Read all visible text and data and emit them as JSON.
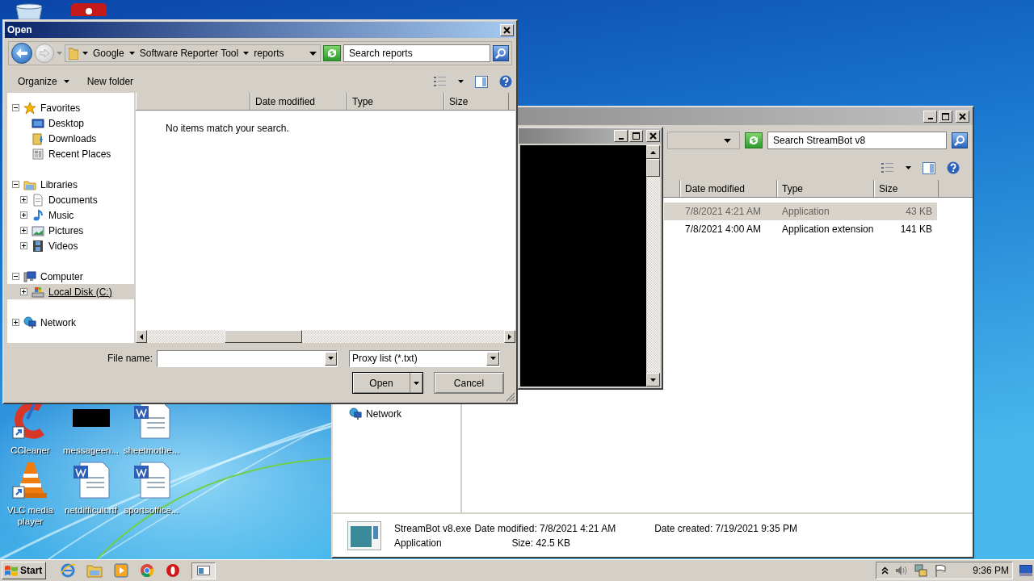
{
  "desktop": {
    "top_icons": [
      {
        "kind": "recycle_bin"
      },
      {
        "kind": "red_app"
      }
    ],
    "icons": [
      {
        "kind": "app_red_c",
        "label": "CCleaner"
      },
      {
        "kind": "blank_thumb",
        "label": "messageen..."
      },
      {
        "kind": "word_doc",
        "label": "sheetmothe..."
      },
      {
        "kind": "cone",
        "label": "VLC media player"
      },
      {
        "kind": "word_doc",
        "label": "netdifficult.rtf"
      },
      {
        "kind": "word_doc",
        "label": "sportsoffice..."
      }
    ]
  },
  "explorer": {
    "search": {
      "placeholder": "Search StreamBot v8"
    },
    "columns": [
      "Date modified",
      "Type",
      "Size"
    ],
    "rows": [
      {
        "date": "7/8/2021 4:21 AM",
        "type": "Application",
        "size": "43 KB",
        "selected": true
      },
      {
        "date": "7/8/2021 4:00 AM",
        "type": "Application extension",
        "size": "141 KB",
        "selected": false
      }
    ],
    "nav": [
      {
        "label": "Network",
        "kind": "network"
      }
    ],
    "details": {
      "name": "StreamBot v8.exe",
      "type": "Application",
      "date_modified_label": "Date modified:",
      "date_modified": "7/8/2021 4:21 AM",
      "size_label": "Size:",
      "size": "42.5 KB",
      "date_created_label": "Date created:",
      "date_created": "7/19/2021 9:35 PM"
    }
  },
  "dialog": {
    "title": "Open",
    "breadcrumb": [
      "Google",
      "Software Reporter Tool",
      "reports"
    ],
    "search": {
      "placeholder": "Search reports"
    },
    "toolbar": [
      {
        "label": "Organize",
        "kind": "menu"
      },
      {
        "label": "New folder",
        "kind": "plain"
      }
    ],
    "columns": [
      "Date modified",
      "Type",
      "Size"
    ],
    "empty_message": "No items match your search.",
    "tree": [
      {
        "label": "Favorites",
        "kind": "favorites",
        "expanded": true,
        "selected": false,
        "children": [
          {
            "label": "Desktop",
            "kind": "desktop",
            "selected": false
          },
          {
            "label": "Downloads",
            "kind": "downloads",
            "selected": false
          },
          {
            "label": "Recent Places",
            "kind": "recent",
            "selected": false
          }
        ]
      },
      {
        "label": "Libraries",
        "kind": "libraries",
        "expanded": true,
        "selected": false,
        "children": [
          {
            "label": "Documents",
            "kind": "documents",
            "expanded": false,
            "selected": false
          },
          {
            "label": "Music",
            "kind": "music",
            "expanded": false,
            "selected": false
          },
          {
            "label": "Pictures",
            "kind": "pictures",
            "expanded": false,
            "selected": false
          },
          {
            "label": "Videos",
            "kind": "videos",
            "expanded": false,
            "selected": false
          }
        ]
      },
      {
        "label": "Computer",
        "kind": "computer",
        "expanded": true,
        "selected": false,
        "children": [
          {
            "label": "Local Disk (C:)",
            "kind": "drive",
            "expanded": false,
            "selected": true
          }
        ]
      },
      {
        "label": "Network",
        "kind": "network",
        "expanded": false,
        "selected": false
      }
    ],
    "file_name_label": "File name:",
    "file_type": "Proxy list (*.txt)",
    "buttons": [
      {
        "label": "Open",
        "kind": "split"
      },
      {
        "label": "Cancel",
        "kind": "plain"
      }
    ]
  },
  "taskbar": {
    "start": "Start",
    "items": [
      {
        "kind": "browser_e"
      },
      {
        "kind": "folder"
      },
      {
        "kind": "player"
      },
      {
        "kind": "browser_round"
      },
      {
        "kind": "red_o"
      },
      {
        "kind": "window"
      }
    ],
    "tray": [
      {
        "kind": "chevron"
      },
      {
        "kind": "speaker"
      },
      {
        "kind": "network"
      },
      {
        "kind": "flag"
      }
    ],
    "clock": "9:36 PM"
  }
}
